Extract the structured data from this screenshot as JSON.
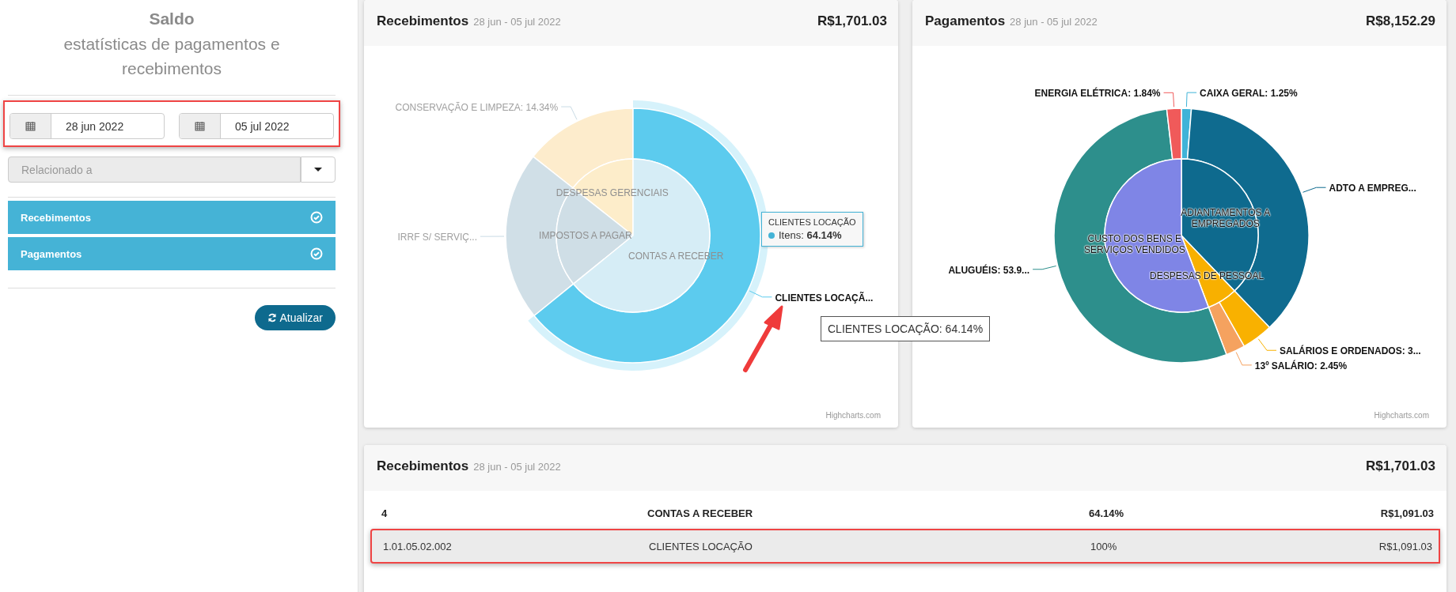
{
  "sidebar": {
    "title": "Saldo",
    "subtitle": "estatísticas de pagamentos e recebimentos",
    "date_from": "28 jun 2022",
    "date_to": "05 jul 2022",
    "related": {
      "placeholder": "Relacionado a"
    },
    "toggles": [
      {
        "label": "Recebimentos",
        "checked": true
      },
      {
        "label": "Pagamentos",
        "checked": true
      }
    ],
    "refresh_button": "Atualizar"
  },
  "charts": [
    {
      "title": "Recebimentos",
      "period": "28 jun - 05 jul 2022",
      "total": "R$1,701.03",
      "credit": "Highcharts.com",
      "donut": {
        "inner": [
          {
            "label": "DESPESAS GERENCIAIS",
            "color": "#fdedca",
            "highlighted": false
          },
          {
            "label": "IMPOSTOS A PAGAR",
            "color": "#cfdee6",
            "highlighted": false
          },
          {
            "label": "CONTAS A RECEBER",
            "color": "#d6edf6",
            "highlighted": false
          }
        ],
        "outer": [
          {
            "label": "CONSERVAÇÃO E LIMPEZA: 14.34%",
            "color": "#fdeccc",
            "highlighted": false
          },
          {
            "label": "IRRF S/ SERVIÇ...",
            "color": "#d0dfe7",
            "highlighted": false
          },
          {
            "label": "CLIENTES LOCAÇÃ...",
            "color": "#5ccbee",
            "highlighted": true
          }
        ]
      },
      "tooltip": {
        "title": "CLIENTES LOCAÇÃO",
        "text": "Itens: **64.14%**",
        "color": "#44b3d6"
      }
    },
    {
      "title": "Pagamentos",
      "period": "28 jun - 05 jul 2022",
      "total": "R$8,152.29",
      "credit": "Highcharts.com",
      "donut": {
        "inner": [
          {
            "label": "ADIANTAMENTOS A EMPREGADOS",
            "color": "#0e6a8e"
          },
          {
            "label": "DESPESAS DE PESSOAL",
            "color": "#f8b000"
          },
          {
            "label": "CUSTO DOS BENS E SERVIÇOS VENDIDOS",
            "color": "#7f85e6"
          }
        ],
        "outer": [
          {
            "label": "CAIXA GERAL: 1.25%",
            "color": "#3fb3d8"
          },
          {
            "label": "ADTO A EMPREG...",
            "color": "#0f6b8f"
          },
          {
            "label": "SALÁRIOS E ORDENADOS: 3...",
            "color": "#f9b100"
          },
          {
            "label": "13º SALÁRIO: 2.45%",
            "color": "#f5a25f"
          },
          {
            "label": "ALUGUÉIS: 53.9...",
            "color": "#2d8f8c"
          },
          {
            "label": "ENERGIA ELÉTRICA: 1.84%",
            "color": "#f05a5a"
          }
        ]
      }
    }
  ],
  "hover_title": "CLIENTES LOCAÇÃO: 64.14%",
  "table": {
    "title": "Recebimentos",
    "period": "28 jun - 05 jul 2022",
    "total": "R$1,701.03",
    "rows": [
      {
        "kind": "group",
        "cells": [
          "4",
          "CONTAS A RECEBER",
          "64.14%",
          "R$1,091.03"
        ],
        "selected": false
      },
      {
        "kind": "item",
        "cells": [
          "1.01.05.02.002",
          "CLIENTES LOCAÇÃO",
          "100%",
          "R$1,091.03"
        ],
        "selected": true
      }
    ]
  }
}
